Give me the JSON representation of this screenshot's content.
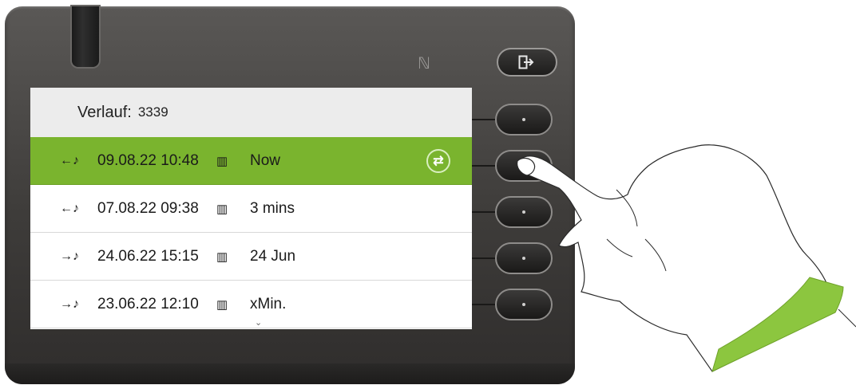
{
  "screen": {
    "header": {
      "title": "Verlauf:",
      "number": "3339"
    },
    "entries": [
      {
        "direction_icon": "incoming-call-icon",
        "direction_glyph": "←♪",
        "datetime": "09.08.22 10:48",
        "type_icon": "building-icon",
        "relative": "Now",
        "selected": true
      },
      {
        "direction_icon": "incoming-call-icon",
        "direction_glyph": "←♪",
        "datetime": "07.08.22 09:38",
        "type_icon": "building-icon",
        "relative": "3 mins",
        "selected": false
      },
      {
        "direction_icon": "outgoing-call-icon",
        "direction_glyph": "→♪",
        "datetime": "24.06.22 15:15",
        "type_icon": "building-icon",
        "relative": "24 Jun",
        "selected": false
      },
      {
        "direction_icon": "outgoing-call-icon",
        "direction_glyph": "→♪",
        "datetime": "23.06.22 12:10",
        "type_icon": "building-icon",
        "relative": "xMin.",
        "selected": false
      }
    ],
    "selected_action_icon": "callback-refresh-icon"
  },
  "colors": {
    "selection": "#7ab42e",
    "cuff": "#8cc63f",
    "housing": "#3e3c3a"
  }
}
